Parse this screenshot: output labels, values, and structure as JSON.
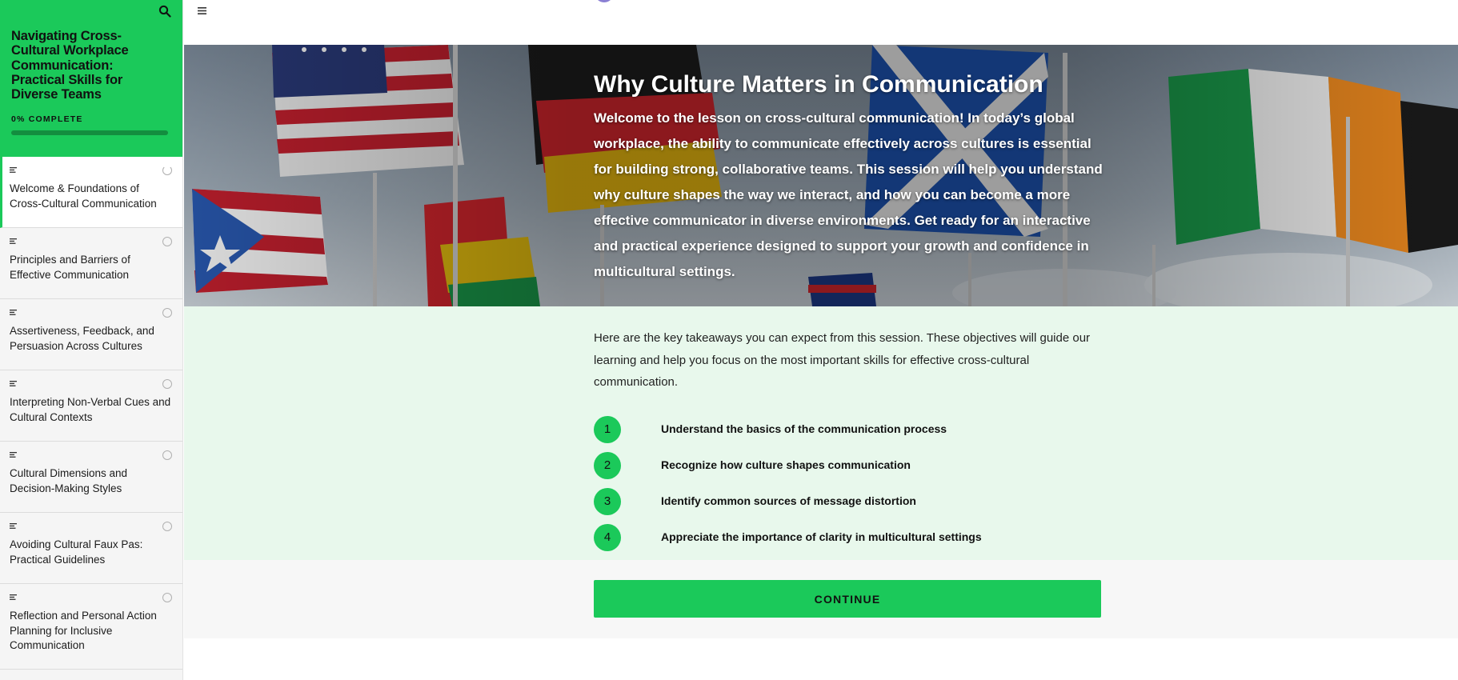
{
  "sidebar": {
    "course_title": "Navigating Cross-Cultural Workplace Communication: Practical Skills for Diverse Teams",
    "progress_label": "0% COMPLETE",
    "progress_fraction": 0,
    "search_icon": "search-icon",
    "lessons": [
      {
        "title": "Welcome & Foundations of Cross-Cultural Communication",
        "status": "in-progress",
        "active": true
      },
      {
        "title": "Principles and Barriers of Effective Communication",
        "status": "not-started"
      },
      {
        "title": "Assertiveness, Feedback, and Persuasion Across Cultures",
        "status": "not-started"
      },
      {
        "title": "Interpreting Non-Verbal Cues and Cultural Contexts",
        "status": "not-started"
      },
      {
        "title": "Cultural Dimensions and Decision-Making Styles",
        "status": "not-started"
      },
      {
        "title": "Avoiding Cultural Faux Pas: Practical Guidelines",
        "status": "not-started"
      },
      {
        "title": "Reflection and Personal Action Planning for Inclusive Communication",
        "status": "not-started"
      }
    ]
  },
  "topbar": {
    "menu_icon": "hamburger-menu-icon"
  },
  "hero": {
    "title": "Why Culture Matters in Communication",
    "text": "Welcome to the lesson on cross-cultural communication! In today’s global workplace, the ability to communicate effectively across cultures is essential for building strong, collaborative teams. This session will help you understand why culture shapes the way we interact, and how you can become a more effective communicator in diverse environments. Get ready for an interactive and practical experience designed to support your growth and confidence in multicultural settings."
  },
  "objectives": {
    "intro": "Here are the key takeaways you can expect from this session. These objectives will guide our learning and help you focus on the most important skills for effective cross-cultural communication.",
    "items": [
      {
        "number": "1",
        "text": "Understand the basics of the communication process"
      },
      {
        "number": "2",
        "text": "Recognize how culture shapes communication"
      },
      {
        "number": "3",
        "text": "Identify common sources of message distortion"
      },
      {
        "number": "4",
        "text": "Appreciate the importance of clarity in multicultural settings"
      }
    ]
  },
  "continue": {
    "label": "CONTINUE"
  },
  "colors": {
    "accent": "#1bc95a",
    "accent_light": "#e8f8ec"
  }
}
